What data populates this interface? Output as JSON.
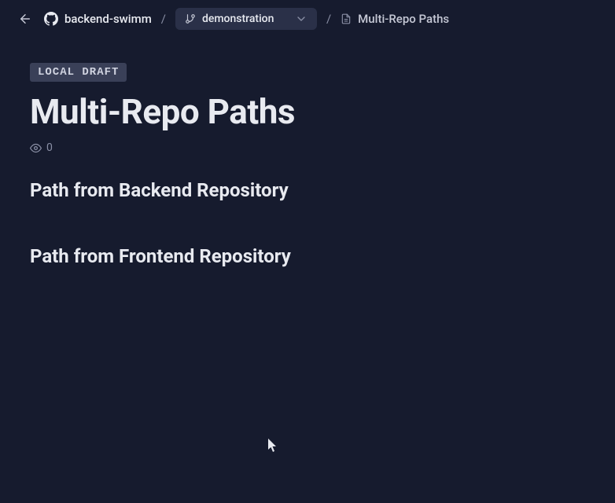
{
  "header": {
    "repo_name": "backend-swimm",
    "branch_name": "demonstration",
    "doc_name": "Multi-Repo Paths",
    "separator": "/"
  },
  "content": {
    "badge": "LOCAL DRAFT",
    "title": "Multi-Repo Paths",
    "view_count": "0",
    "sections": [
      "Path from Backend Repository",
      "Path from Frontend Repository"
    ]
  }
}
